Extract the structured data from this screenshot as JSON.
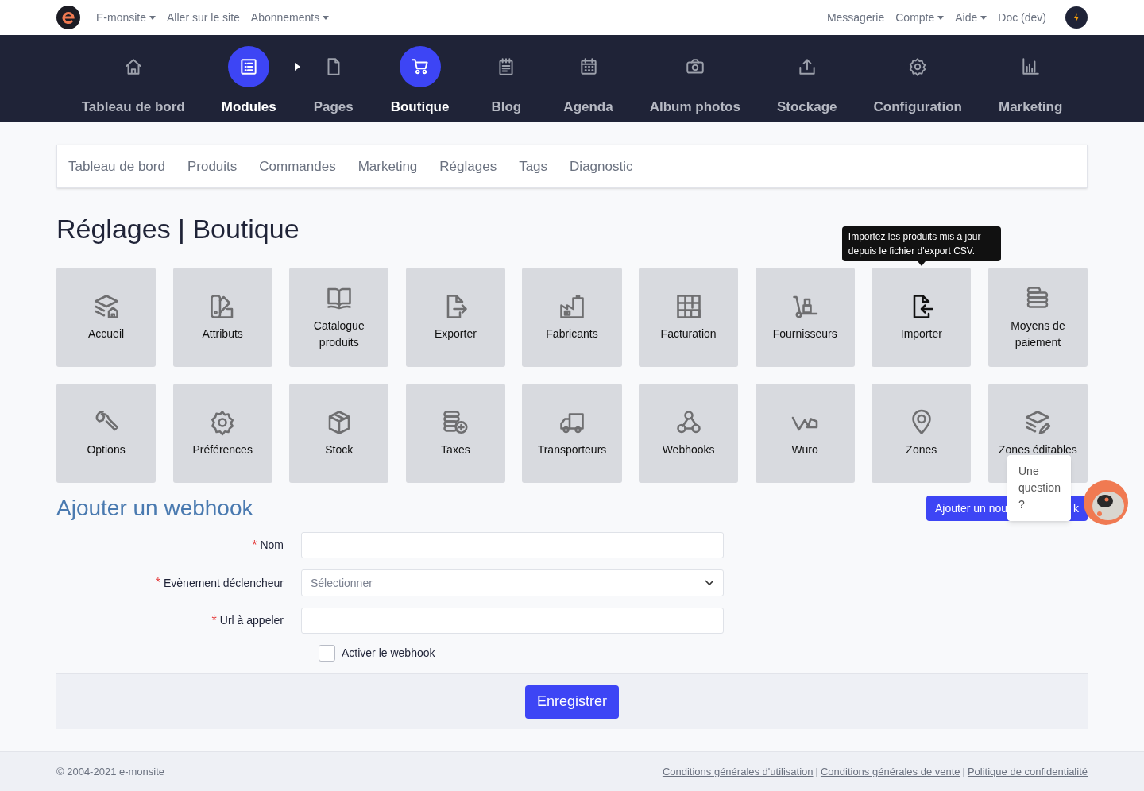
{
  "top_bar": {
    "left_links": [
      {
        "label": "E-monsite",
        "dropdown": true
      },
      {
        "label": "Aller sur le site",
        "dropdown": false
      },
      {
        "label": "Abonnements",
        "dropdown": true
      }
    ],
    "right_links": [
      {
        "label": "Messagerie",
        "dropdown": false
      },
      {
        "label": "Compte",
        "dropdown": true
      },
      {
        "label": "Aide",
        "dropdown": true
      },
      {
        "label": "Doc (dev)",
        "dropdown": false
      }
    ]
  },
  "main_nav": [
    {
      "label": "Tableau de bord",
      "selected": false
    },
    {
      "label": "Modules",
      "selected": true
    },
    {
      "label": "Pages",
      "selected": false
    },
    {
      "label": "Boutique",
      "selected": true
    },
    {
      "label": "Blog",
      "selected": false
    },
    {
      "label": "Agenda",
      "selected": false
    },
    {
      "label": "Album photos",
      "selected": false
    },
    {
      "label": "Stockage",
      "selected": false
    },
    {
      "label": "Configuration",
      "selected": false
    },
    {
      "label": "Marketing",
      "selected": false
    }
  ],
  "sub_tabs": [
    "Tableau de bord",
    "Produits",
    "Commandes",
    "Marketing",
    "Réglages",
    "Tags",
    "Diagnostic"
  ],
  "page_title": "Réglages | Boutique",
  "tiles": [
    {
      "label": "Accueil",
      "hovered": false
    },
    {
      "label": "Attributs",
      "hovered": false
    },
    {
      "label": "Catalogue produits",
      "hovered": false
    },
    {
      "label": "Exporter",
      "hovered": false
    },
    {
      "label": "Fabricants",
      "hovered": false
    },
    {
      "label": "Facturation",
      "hovered": false
    },
    {
      "label": "Fournisseurs",
      "hovered": false
    },
    {
      "label": "Importer",
      "hovered": true,
      "tooltip": "Importez les produits mis à jour depuis le fichier d'export CSV."
    },
    {
      "label": "Moyens de paiement",
      "hovered": false
    },
    {
      "label": "Options",
      "hovered": false
    },
    {
      "label": "Préférences",
      "hovered": false
    },
    {
      "label": "Stock",
      "hovered": false
    },
    {
      "label": "Taxes",
      "hovered": false
    },
    {
      "label": "Transporteurs",
      "hovered": false
    },
    {
      "label": "Webhooks",
      "hovered": false
    },
    {
      "label": "Wuro",
      "hovered": false
    },
    {
      "label": "Zones",
      "hovered": false
    },
    {
      "label": "Zones éditables",
      "hovered": false
    }
  ],
  "webhook_form": {
    "title": "Ajouter un webhook",
    "add_button": {
      "label_start": "Ajouter un nou",
      "label_end": "k"
    },
    "fields": [
      {
        "label": "Nom",
        "required_mark": "*",
        "kind": "text"
      },
      {
        "label": "Evènement déclencheur",
        "required_mark": "*",
        "kind": "select",
        "placeholder": "Sélectionner"
      },
      {
        "label": "Url à appeler",
        "required_mark": "*",
        "kind": "text"
      }
    ],
    "checkbox": {
      "label": "Activer le webhook",
      "checked": false
    },
    "submit": "Enregistrer"
  },
  "chat": {
    "bubble": "Une question ?"
  },
  "footer": {
    "copyright": "© 2004-2021 e-monsite",
    "links": [
      {
        "label": "Conditions générales d'utilisation"
      },
      {
        "separator": "|"
      },
      {
        "label": "Conditions générales de vente"
      },
      {
        "separator": "|"
      },
      {
        "label": "Politique de confidentialité"
      }
    ]
  }
}
